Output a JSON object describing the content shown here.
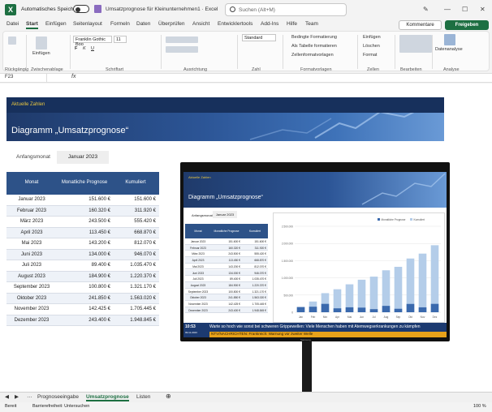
{
  "titlebar": {
    "autosave_label": "Automatisches Speichern",
    "doc_title": "Umsatzprognose für Kleinunternehmen1 · Excel",
    "search_placeholder": "Suchen (Alt+M)"
  },
  "ribbon_tabs": [
    "Datei",
    "Start",
    "Einfügen",
    "Seitenlayout",
    "Formeln",
    "Daten",
    "Überprüfen",
    "Ansicht",
    "Entwicklertools",
    "Add-Ins",
    "Hilfe",
    "Team"
  ],
  "active_tab": "Start",
  "buttons": {
    "comments": "Kommentare",
    "share": "Freigeben"
  },
  "ribbon": {
    "clipboard_paste": "Einfügen",
    "font_name": "Franklin Gothic Boo",
    "font_size": "11",
    "number_format": "Standard",
    "cond_format": "Bedingte Formatierung",
    "as_table": "Als Tabelle formatieren",
    "cell_styles": "Zellenformatvorlagen",
    "insert": "Einfügen",
    "delete": "Löschen",
    "format": "Format",
    "data_analysis": "Datenanalyse",
    "groups": [
      "Rückgängig",
      "Zwischenablage",
      "Schriftart",
      "Ausrichtung",
      "Zahl",
      "Formatvorlagen",
      "Zellen",
      "Bearbeiten",
      "Analyse"
    ]
  },
  "formula_bar": {
    "name_box": "F23",
    "fx": "fx",
    "value": ""
  },
  "sheet": {
    "banner_subtitle": "Aktuelle Zahlen",
    "banner_title": "Diagramm „Umsatzprognose“",
    "start_label": "Anfangsmonat",
    "start_value": "Januar 2023",
    "table_headers": [
      "Monat",
      "Monatliche Prognose",
      "Kumuliert"
    ],
    "rows": [
      [
        "Januar 2023",
        "151.600 €",
        "151.600 €"
      ],
      [
        "Februar 2023",
        "160.320 €",
        "311.920 €"
      ],
      [
        "März 2023",
        "243.500 €",
        "555.420 €"
      ],
      [
        "April 2023",
        "113.450 €",
        "668.870 €"
      ],
      [
        "Mai 2023",
        "143.200 €",
        "812.070 €"
      ],
      [
        "Juni 2023",
        "134.000 €",
        "946.070 €"
      ],
      [
        "Juli 2023",
        "89.400 €",
        "1.035.470 €"
      ],
      [
        "August 2023",
        "184.900 €",
        "1.220.370 €"
      ],
      [
        "September 2023",
        "100.800 €",
        "1.321.170 €"
      ],
      [
        "Oktober 2023",
        "241.850 €",
        "1.563.020 €"
      ],
      [
        "November 2023",
        "142.425 €",
        "1.705.445 €"
      ],
      [
        "Dezember 2023",
        "243.400 €",
        "1.948.845 €"
      ]
    ]
  },
  "monitor": {
    "legend": [
      "Monatliche Prognose",
      "Kumuliert"
    ],
    "y_ticks": [
      "2.500.000",
      "2.000.000",
      "1.500.000",
      "1.000.000",
      "500.000",
      "0"
    ],
    "x_labels": [
      "Jan",
      "Feb",
      "Mrz",
      "Apr",
      "Mai",
      "Jun",
      "Jul",
      "Aug",
      "Sep",
      "Okt",
      "Nov",
      "Dez"
    ],
    "ticker_time": "10:53",
    "ticker_date": "09.11.2023",
    "ticker_line1": "Warte so hoch wie sonst bei schweren Grippewellen: Viele Menschen haben mit Atemwegserkrankungen zu kämpfen",
    "ticker_line2": "NTV/NACHRICHTEN: Frankreich: Warnung vor zweiter Welle",
    "brand": "Samsung"
  },
  "chart_data": {
    "type": "bar",
    "categories": [
      "Jan",
      "Feb",
      "Mrz",
      "Apr",
      "Mai",
      "Jun",
      "Jul",
      "Aug",
      "Sep",
      "Okt",
      "Nov",
      "Dez"
    ],
    "series": [
      {
        "name": "Monatliche Prognose",
        "values": [
          151600,
          160320,
          243500,
          113450,
          143200,
          134000,
          89400,
          184900,
          100800,
          241850,
          142425,
          243400
        ]
      },
      {
        "name": "Kumuliert",
        "values": [
          151600,
          311920,
          555420,
          668870,
          812070,
          946070,
          1035470,
          1220370,
          1321170,
          1563020,
          1705445,
          1948845
        ]
      }
    ],
    "ylim": [
      0,
      2500000
    ],
    "legend": "top-right"
  },
  "sheet_tabs": [
    "Prognoseeingabe",
    "Umsatzprognose",
    "Listen"
  ],
  "active_sheet": "Umsatzprognose",
  "status": {
    "ready": "Bereit",
    "accessibility": "Barrierefreiheit: Untersuchen",
    "zoom": "100 %"
  },
  "colors": {
    "excel_green": "#1d6f42",
    "table_header": "#2d5288",
    "bar_monthly": "#3a69ad",
    "bar_cumulative": "#b4cde9"
  }
}
